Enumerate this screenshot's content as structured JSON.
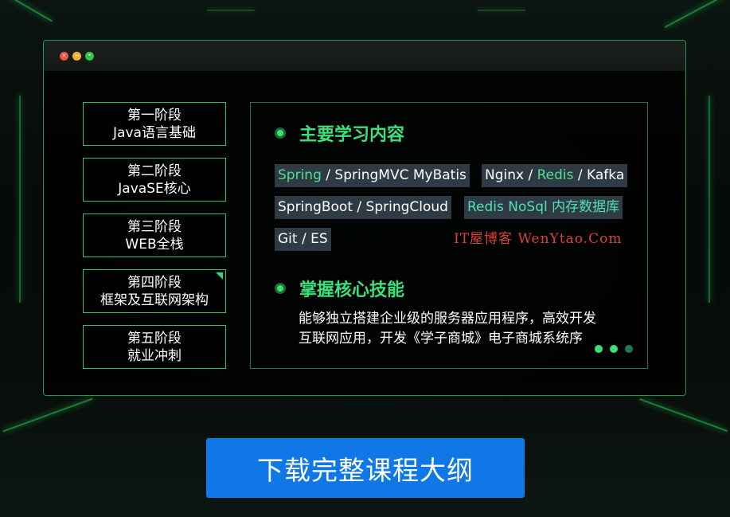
{
  "window": {
    "controls": {
      "close_glyph": "×",
      "minimize_glyph": "−",
      "maximize_glyph": "•"
    }
  },
  "stages": [
    {
      "title": "第一阶段",
      "subtitle": "Java语言基础"
    },
    {
      "title": "第二阶段",
      "subtitle": "JavaSE核心"
    },
    {
      "title": "第三阶段",
      "subtitle": "WEB全栈"
    },
    {
      "title": "第四阶段",
      "subtitle": "框架及互联网架构",
      "active": true
    },
    {
      "title": "第五阶段",
      "subtitle": "就业冲刺"
    }
  ],
  "content": {
    "section1_title": "主要学习内容",
    "tags": {
      "t1_hl": "Spring",
      "t1_rest": " / SpringMVC MyBatis",
      "t2_a": "Nginx / ",
      "t2_hl": "Redis",
      "t2_b": " / Kafka",
      "t3": "SpringBoot / SpringCloud",
      "t4": "Redis NoSql 内存数据库",
      "t5": "Git / ES"
    },
    "watermark": "IT屋博客 WenYtao.Com",
    "section2_title": "掌握核心技能",
    "description_line1": "能够独立搭建企业级的服务器应用程序，高效开发",
    "description_line2": "互联网应用，开发《学子商城》电子商城系统序"
  },
  "cta_label": "下载完整课程大纲",
  "colors": {
    "accent_green": "#3ae07a",
    "border_green": "#2fc36a",
    "tag_bg": "#2f3b44",
    "cta_blue": "#0f78e6",
    "watermark_red": "#d9423a"
  }
}
